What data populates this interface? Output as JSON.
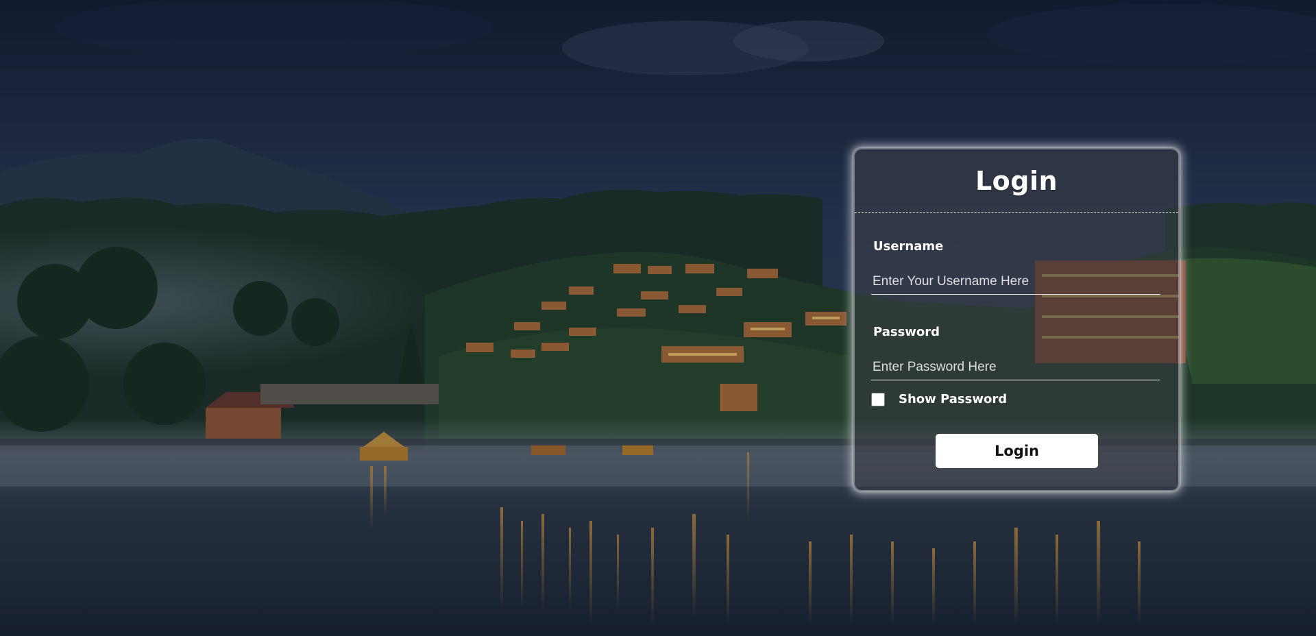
{
  "colors": {
    "card_background": "#3c3e46",
    "card_glow": "#ffffff",
    "text": "#ffffff",
    "button_background": "#ffffff",
    "button_text": "#111111",
    "sky": "#1d2a44",
    "water": "#2b3546"
  },
  "login": {
    "title": "Login",
    "username": {
      "label": "Username",
      "value": "",
      "placeholder": "Enter Your Username Here"
    },
    "password": {
      "label": "Password",
      "value": "",
      "placeholder": "Enter Password Here"
    },
    "show_password": {
      "label": "Show Password",
      "checked": false
    },
    "submit_label": "Login"
  },
  "background": {
    "icon": "misty-lakeside-village-photo"
  }
}
